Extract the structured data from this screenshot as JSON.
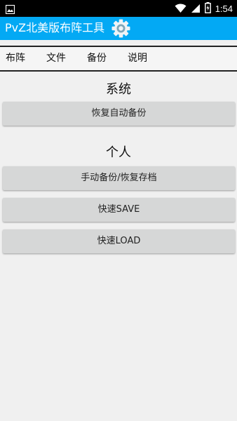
{
  "status_bar": {
    "time": "1:54",
    "icons": [
      "image-icon",
      "wifi-icon",
      "signal-icon",
      "battery-charging-icon"
    ]
  },
  "app_bar": {
    "title": "PvZ北美版布阵工具",
    "settings_icon": "gear-icon",
    "color": "#03a9f4"
  },
  "tabs": [
    {
      "label": "布阵"
    },
    {
      "label": "文件"
    },
    {
      "label": "备份"
    },
    {
      "label": "说明"
    }
  ],
  "sections": {
    "system": {
      "title": "系统",
      "buttons": [
        {
          "label": "恢复自动备份"
        }
      ]
    },
    "personal": {
      "title": "个人",
      "buttons": [
        {
          "label": "手动备份/恢复存档"
        },
        {
          "label": "快速SAVE"
        },
        {
          "label": "快速LOAD"
        }
      ]
    }
  }
}
